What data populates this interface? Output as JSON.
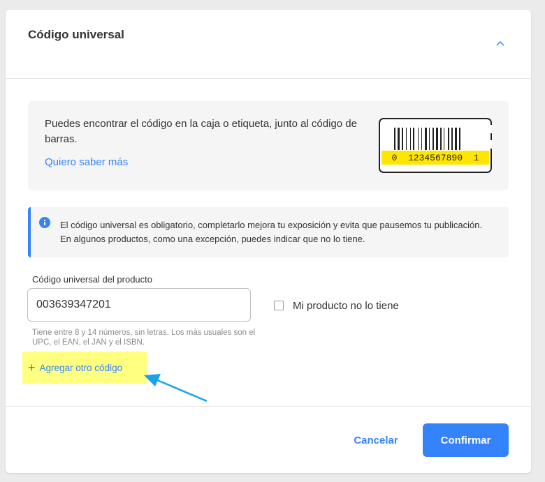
{
  "section": {
    "title": "Código universal"
  },
  "info": {
    "text": "Puedes encontrar el código en la caja o etiqueta, junto al código de barras.",
    "link": "Quiero saber más",
    "barcode_number": "0  1234567890  1"
  },
  "notice": {
    "text": "El código universal es obligatorio, completarlo mejora tu exposición y evita que pausemos tu publicación. En algunos productos, como una excepción, puedes indicar que no lo tiene."
  },
  "field": {
    "label": "Código universal del producto",
    "value": "003639347201",
    "helper": "Tiene entre 8 y 14 números, sin letras. Los más usuales son el UPC, el EAN, el JAN y el ISBN."
  },
  "checkbox": {
    "label": "Mi producto no lo tiene",
    "checked": false
  },
  "add_code": {
    "label": "Agregar otro código",
    "highlight_color": "#ffff80"
  },
  "buttons": {
    "cancel": "Cancelar",
    "confirm": "Confirmar"
  },
  "colors": {
    "accent": "#3483fa",
    "annotation_arrow": "#1aa3e8"
  }
}
